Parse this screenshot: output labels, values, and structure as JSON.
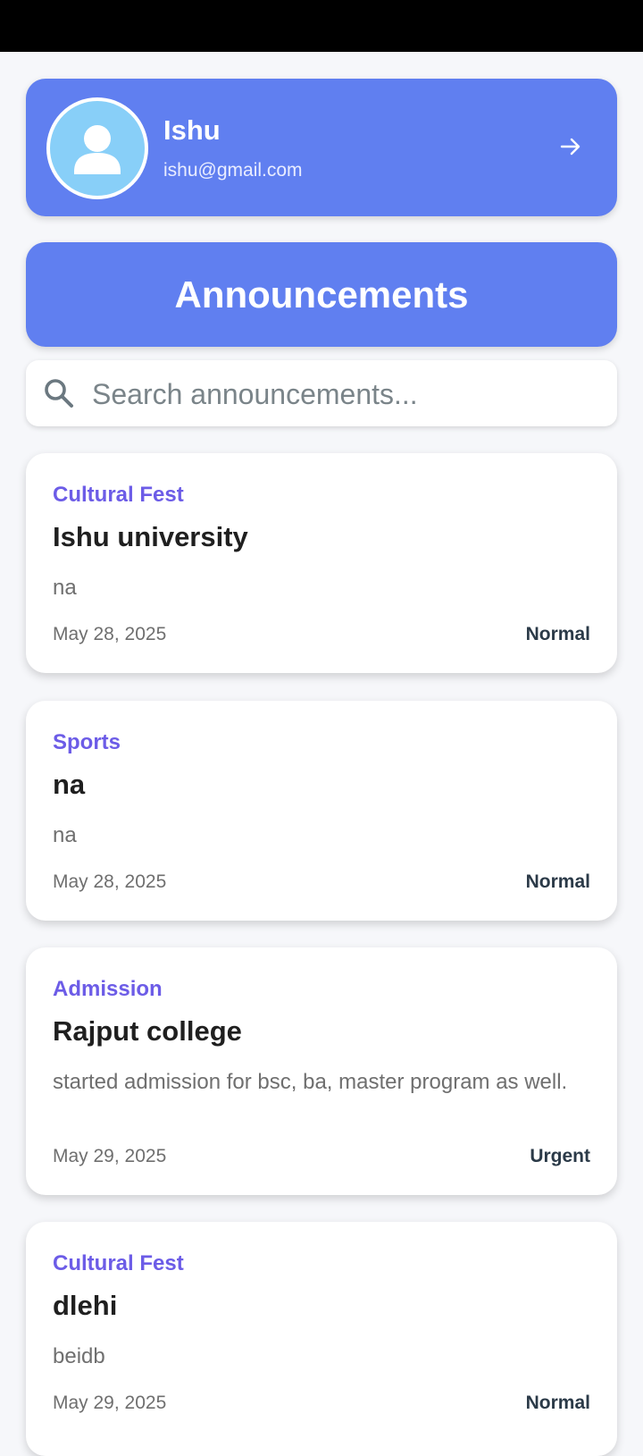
{
  "profile": {
    "name": "Ishu",
    "email": "ishu@gmail.com"
  },
  "page_title": "Announcements",
  "search": {
    "placeholder": "Search announcements...",
    "value": ""
  },
  "announcements": [
    {
      "category": "Cultural Fest",
      "title": "Ishu university",
      "description": "na",
      "date": "May 28, 2025",
      "priority": "Normal"
    },
    {
      "category": "Sports",
      "title": "na",
      "description": "na",
      "date": "May 28, 2025",
      "priority": "Normal"
    },
    {
      "category": "Admission",
      "title": "Rajput college",
      "description": "started admission for bsc, ba, master program as well.",
      "date": "May 29, 2025",
      "priority": "Urgent"
    },
    {
      "category": "Cultural Fest",
      "title": "dlehi",
      "description": "beidb",
      "date": "May 29, 2025",
      "priority": "Normal"
    }
  ],
  "colors": {
    "accent": "#607ff0",
    "category": "#6c5ce7",
    "background": "#f6f7fa"
  },
  "icons": {
    "avatar": "person-icon",
    "profile_arrow": "arrow-right-icon",
    "search": "search-icon"
  }
}
